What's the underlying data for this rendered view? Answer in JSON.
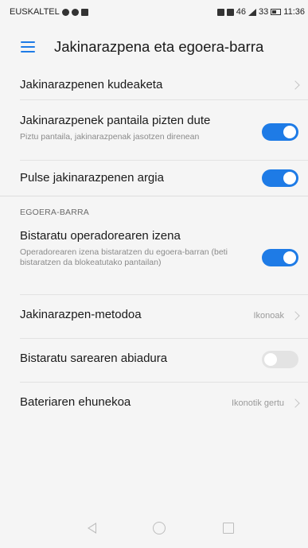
{
  "status_bar": {
    "carrier": "EUSKALTEL",
    "signal_text": "46",
    "battery_text": "33",
    "time": "11:36"
  },
  "toolbar": {
    "title": "Jakinarazpena eta egoera-barra"
  },
  "notifications": {
    "manage_label": "Jakinarazpenen kudeaketa",
    "wake_screen_title": "Jakinarazpenek pantaila pizten dute",
    "wake_screen_subtitle": "Piztu pantaila, jakinarazpenak jasotzen direnean",
    "wake_screen_enabled": true,
    "pulse_light_title": "Pulse jakinarazpenen argia",
    "pulse_light_enabled": true
  },
  "status_section": {
    "header": "EGOERA-BARRA",
    "operator_name_title": "Bistaratu operadorearen izena",
    "operator_name_subtitle": "Operadorearen izena bistaratzen du egoera-barran (beti bistaratzen da blokeatutako pantailan)",
    "operator_name_enabled": true,
    "method_label": "Jakinarazpen-metodoa",
    "method_value": "Ikonoak",
    "network_speed_label": "Bistaratu sarearen abiadura",
    "network_speed_enabled": false,
    "battery_percent_label": "Bateriaren ehunekoa",
    "battery_percent_value": "Ikonotik gertu"
  },
  "colors": {
    "accent": "#1e7be6",
    "toggle_off": "#e3e3e3",
    "background": "#f5f5f5"
  },
  "icons": [
    "menu-icon",
    "chevron-right-icon",
    "back-icon",
    "home-icon",
    "recents-icon"
  ]
}
